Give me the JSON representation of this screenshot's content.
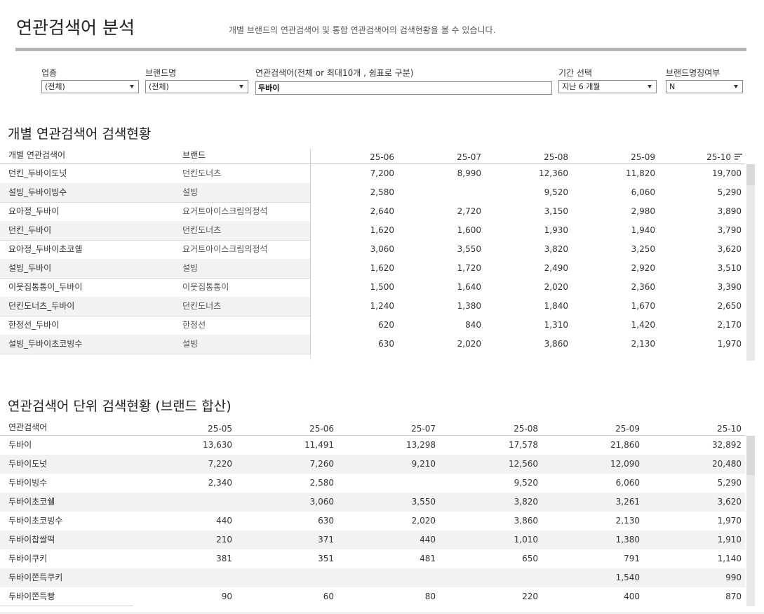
{
  "header": {
    "title": "연관검색어 분석",
    "subtitle": "개별 브랜드의 연관검색어 및 통합 연관검색어의 검색현황을 볼 수 있습니다."
  },
  "filters": {
    "industry": {
      "label": "업종",
      "value": "(전체)"
    },
    "brand": {
      "label": "브랜드명",
      "value": "(전체)"
    },
    "keyword": {
      "label": "연관검색어(전체 or 최대10개 , 쉼표로 구분)",
      "value": "두바이"
    },
    "period": {
      "label": "기간 선택",
      "value": "지난 6 개월"
    },
    "brand_name_match": {
      "label": "브랜드명칭여부",
      "value": "N"
    }
  },
  "table1": {
    "title": "개별 연관검색어 검색현황",
    "headers": {
      "keyword": "개별 연관검색어",
      "brand": "브랜드"
    },
    "months": [
      "25-06",
      "25-07",
      "25-08",
      "25-09",
      "25-10"
    ],
    "rows": [
      {
        "keyword": "던킨_두바이도넛",
        "brand": "던킨도너츠",
        "values": [
          "7,200",
          "8,990",
          "12,360",
          "11,820",
          "19,700"
        ]
      },
      {
        "keyword": "설빙_두바이빙수",
        "brand": "설빙",
        "values": [
          "2,580",
          "",
          "9,520",
          "6,060",
          "5,290"
        ]
      },
      {
        "keyword": "요아정_두바이",
        "brand": "요거트아이스크림의정석",
        "values": [
          "2,640",
          "2,720",
          "3,150",
          "2,980",
          "3,890"
        ]
      },
      {
        "keyword": "던킨_두바이",
        "brand": "던킨도너츠",
        "values": [
          "1,620",
          "1,600",
          "1,930",
          "1,940",
          "3,790"
        ]
      },
      {
        "keyword": "요아정_두바이초코쉘",
        "brand": "요거트아이스크림의정석",
        "values": [
          "3,060",
          "3,550",
          "3,820",
          "3,250",
          "3,620"
        ]
      },
      {
        "keyword": "설빙_두바이",
        "brand": "설빙",
        "values": [
          "1,620",
          "1,720",
          "2,490",
          "2,920",
          "3,510"
        ]
      },
      {
        "keyword": "이웃집통통이_두바이",
        "brand": "이웃집통통이",
        "values": [
          "1,500",
          "1,640",
          "2,020",
          "2,360",
          "3,390"
        ]
      },
      {
        "keyword": "던킨도너츠_두바이",
        "brand": "던킨도너츠",
        "values": [
          "1,240",
          "1,380",
          "1,840",
          "1,670",
          "2,650"
        ]
      },
      {
        "keyword": "한정선_두바이",
        "brand": "한정선",
        "values": [
          "620",
          "840",
          "1,310",
          "1,420",
          "2,170"
        ]
      },
      {
        "keyword": "설빙_두바이초코빙수",
        "brand": "설빙",
        "values": [
          "630",
          "2,020",
          "3,860",
          "2,130",
          "1,970"
        ]
      }
    ]
  },
  "table2": {
    "title": "연관검색어 단위 검색현황 (브랜드 합산)",
    "headers": {
      "keyword": "연관검색어"
    },
    "months": [
      "25-05",
      "25-06",
      "25-07",
      "25-08",
      "25-09",
      "25-10"
    ],
    "rows": [
      {
        "keyword": "두바이",
        "values": [
          "13,630",
          "11,491",
          "13,298",
          "17,578",
          "21,860",
          "32,892"
        ]
      },
      {
        "keyword": "두바이도넛",
        "values": [
          "7,220",
          "7,260",
          "9,210",
          "12,560",
          "12,090",
          "20,480"
        ]
      },
      {
        "keyword": "두바이빙수",
        "values": [
          "2,340",
          "2,580",
          "",
          "9,520",
          "6,060",
          "5,290"
        ]
      },
      {
        "keyword": "두바이초코쉘",
        "values": [
          "",
          "3,060",
          "3,550",
          "3,820",
          "3,261",
          "3,620"
        ]
      },
      {
        "keyword": "두바이초코빙수",
        "values": [
          "440",
          "630",
          "2,020",
          "3,860",
          "2,130",
          "1,970"
        ]
      },
      {
        "keyword": "두바이찹쌀떡",
        "values": [
          "210",
          "371",
          "440",
          "1,010",
          "1,380",
          "1,910"
        ]
      },
      {
        "keyword": "두바이쿠키",
        "values": [
          "381",
          "351",
          "481",
          "650",
          "791",
          "1,140"
        ]
      },
      {
        "keyword": "두바이쫀득쿠키",
        "values": [
          "",
          "",
          "",
          "",
          "1,540",
          "990"
        ]
      },
      {
        "keyword": "두바이쫀득빵",
        "values": [
          "90",
          "60",
          "80",
          "220",
          "400",
          "870"
        ]
      }
    ]
  }
}
